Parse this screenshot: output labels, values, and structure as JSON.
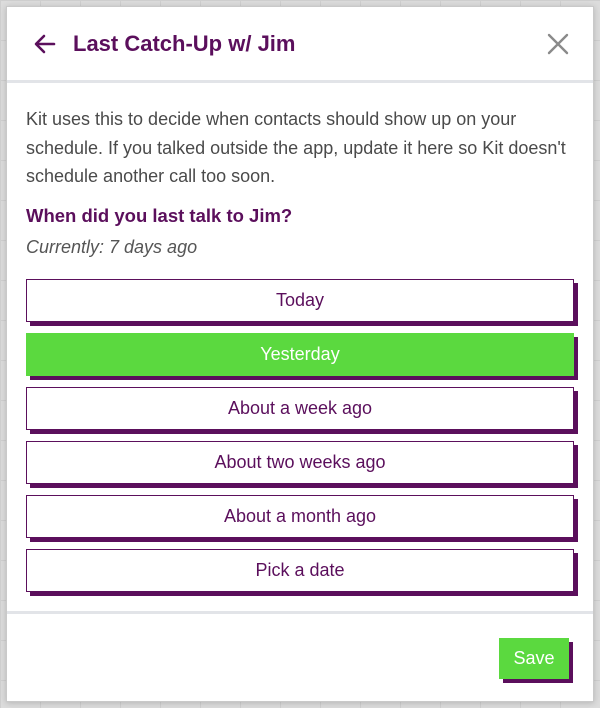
{
  "modal": {
    "title": "Last Catch-Up w/ Jim",
    "back_icon": "arrow-left-icon",
    "close_icon": "close-icon"
  },
  "content": {
    "intro": "Kit uses this to decide when contacts should show up on your schedule. If you talked outside the app, update it here so Kit doesn't schedule another call too soon.",
    "question": "When did you last talk to Jim?",
    "current": "Currently: 7 days ago"
  },
  "options": [
    {
      "label": "Today",
      "selected": false
    },
    {
      "label": "Yesterday",
      "selected": true
    },
    {
      "label": "About a week ago",
      "selected": false
    },
    {
      "label": "About two weeks ago",
      "selected": false
    },
    {
      "label": "About a month ago",
      "selected": false
    },
    {
      "label": "Pick a date",
      "selected": false
    }
  ],
  "footer": {
    "save_label": "Save"
  },
  "colors": {
    "brand_purple": "#5b0f5c",
    "accent_green": "#5bd93f",
    "text_gray": "#4a4a4a"
  }
}
